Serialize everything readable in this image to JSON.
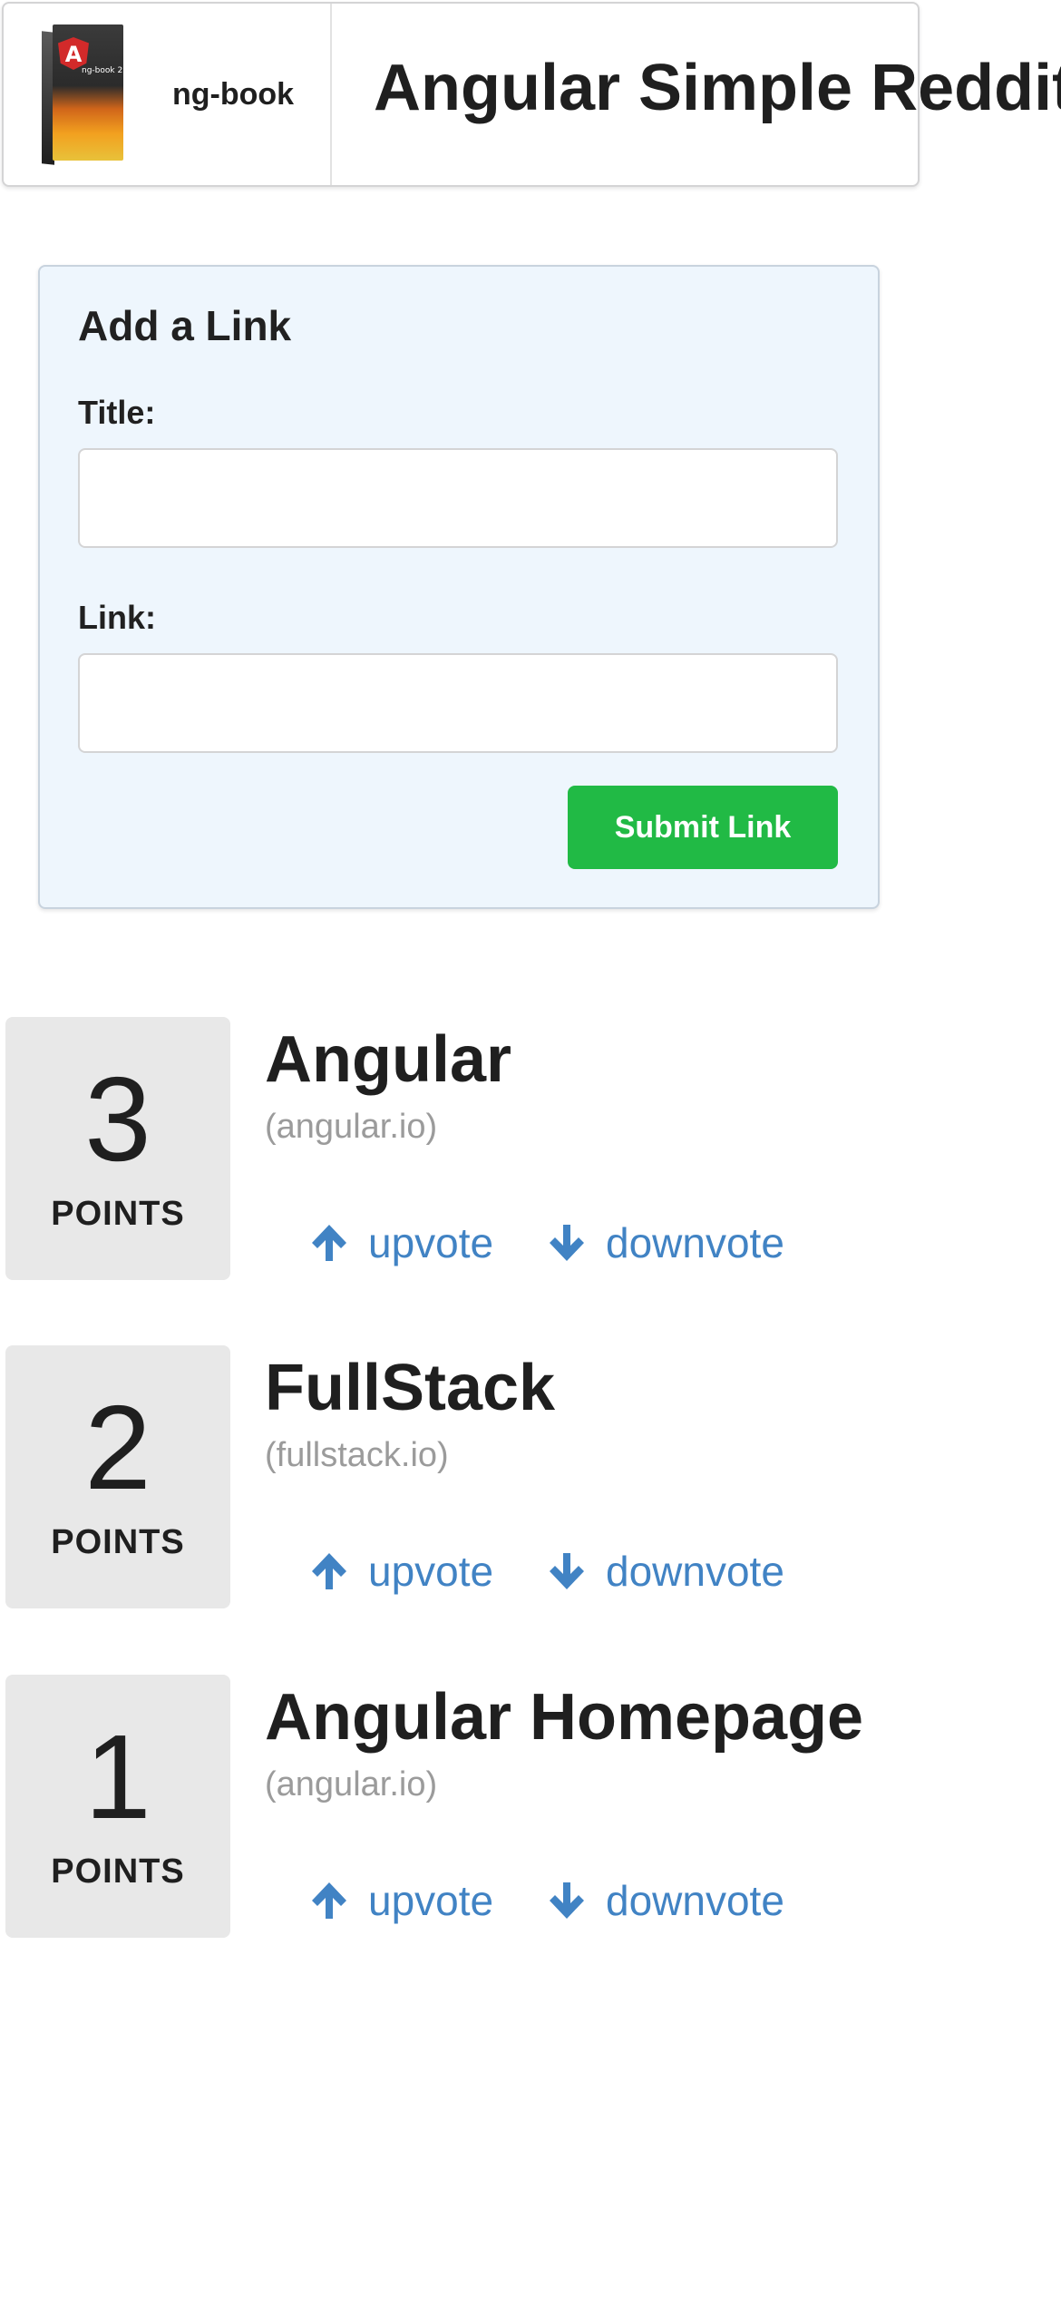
{
  "header": {
    "brand_name": "ng-book",
    "book_cover_logo": "A",
    "book_cover_title": "ng-book 2",
    "app_title": "Angular Simple Reddit"
  },
  "form": {
    "heading": "Add a Link",
    "title_label": "Title:",
    "title_value": "",
    "link_label": "Link:",
    "link_value": "",
    "submit_label": "Submit Link",
    "submit_color": "#21ba45",
    "background_color": "#eef6fd"
  },
  "articles": [
    {
      "votes": "3",
      "votes_label": "POINTS",
      "title": "Angular",
      "domain": "(angular.io)",
      "upvote": "upvote",
      "downvote": "downvote"
    },
    {
      "votes": "2",
      "votes_label": "POINTS",
      "title": "FullStack",
      "domain": "(fullstack.io)",
      "upvote": "upvote",
      "downvote": "downvote"
    },
    {
      "votes": "1",
      "votes_label": "POINTS",
      "title": "Angular Homepage",
      "domain": "(angular.io)",
      "upvote": "upvote",
      "downvote": "downvote"
    }
  ],
  "icons": {
    "upvote": "arrow-up-icon",
    "downvote": "arrow-down-icon"
  },
  "colors": {
    "link": "#4183c4",
    "votes_box": "#e8e8e8",
    "domain_text": "#9b9b9b"
  }
}
